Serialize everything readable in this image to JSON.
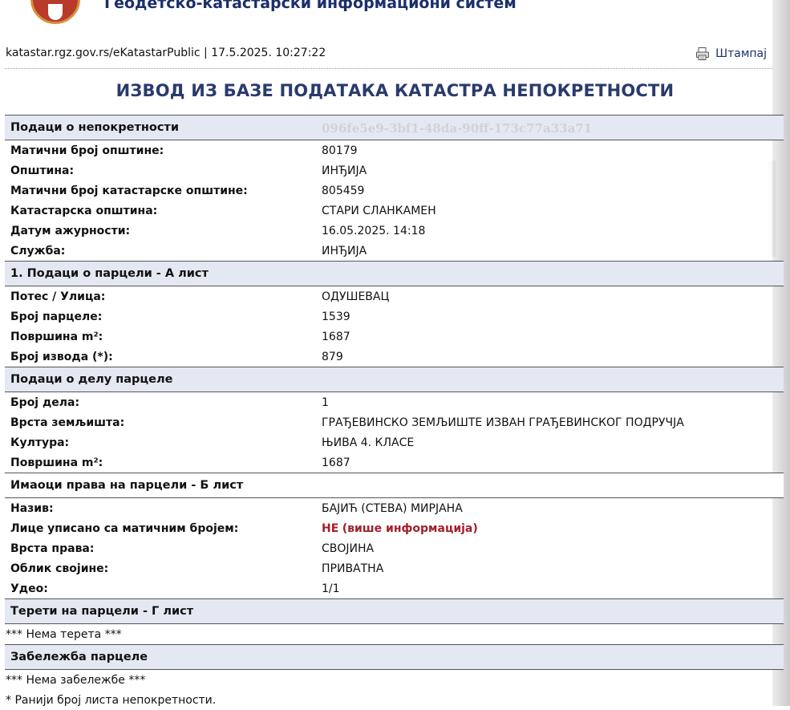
{
  "app": {
    "title": "Геодетско-катастарски информациони систем",
    "source_line": "katastar.rgz.gov.rs/eKatastarPublic | 17.5.2025. 10:27:22",
    "print_label": "Штампај",
    "print_icon": "printer-icon"
  },
  "document": {
    "title": "ИЗВОД ИЗ БАЗЕ ПОДАТАКА КАТАСТРА НЕПОКРЕТНОСТИ",
    "property": {
      "heading": "Подаци о непокретности",
      "id": "096fe5e9-3bf1-48da-90ff-173c77a33a71",
      "rows": [
        {
          "label": "Матични број општине:",
          "value": "80179"
        },
        {
          "label": "Општина:",
          "value": "ИНЂИЈА"
        },
        {
          "label": "Матични број катастарске општине:",
          "value": "805459"
        },
        {
          "label": "Катастарска општина:",
          "value": "СТАРИ СЛАНКАМЕН"
        },
        {
          "label": "Датум ажурности:",
          "value": "16.05.2025. 14:18"
        },
        {
          "label": "Служба:",
          "value": "ИНЂИЈА"
        }
      ]
    },
    "parcel": {
      "heading": "1. Подаци о парцели - А лист",
      "rows": [
        {
          "label": "Потес / Улица:",
          "value": "ОДУШЕВАЦ"
        },
        {
          "label": "Број парцеле:",
          "value": "1539"
        },
        {
          "label": "Површина m²:",
          "value": "1687"
        },
        {
          "label": "Број извода (*):",
          "value": "879"
        }
      ]
    },
    "parcel_part": {
      "heading": "Подаци о делу парцеле",
      "rows": [
        {
          "label": "Број дела:",
          "value": "1"
        },
        {
          "label": "Врста земљишта:",
          "value": "ГРАЂЕВИНСКО ЗЕМЉИШТЕ ИЗВАН ГРАЂЕВИНСКОГ ПОДРУЧЈА"
        },
        {
          "label": "Култура:",
          "value": "ЊИВА 4. КЛАСЕ"
        },
        {
          "label": "Површина m²:",
          "value": "1687"
        }
      ]
    },
    "owners": {
      "heading": "Имаоци права на парцели - Б лист",
      "name_label": "Назив:",
      "name_value": "БАЈИЋ (СТЕВА) МИРЈАНА",
      "registered_label": "Лице уписано са матичним бројем:",
      "registered_value": "НЕ",
      "more_info": "(више информација)",
      "rows": [
        {
          "label": "Врста права:",
          "value": "СВОЈИНА"
        },
        {
          "label": "Облик својине:",
          "value": "ПРИВАТНА"
        },
        {
          "label": "Удео:",
          "value": "1/1"
        }
      ]
    },
    "burdens": {
      "heading": "Терети на парцели - Г лист",
      "note": "*** Нема терета ***"
    },
    "remarks": {
      "heading": "Забележба парцеле",
      "note": "*** Нема забележбе ***"
    },
    "footnote": "* Ранији број листа непокретности."
  },
  "colors": {
    "section_bg": "#e4e8f2",
    "title": "#2a3a6c",
    "alert": "#a3202a"
  }
}
